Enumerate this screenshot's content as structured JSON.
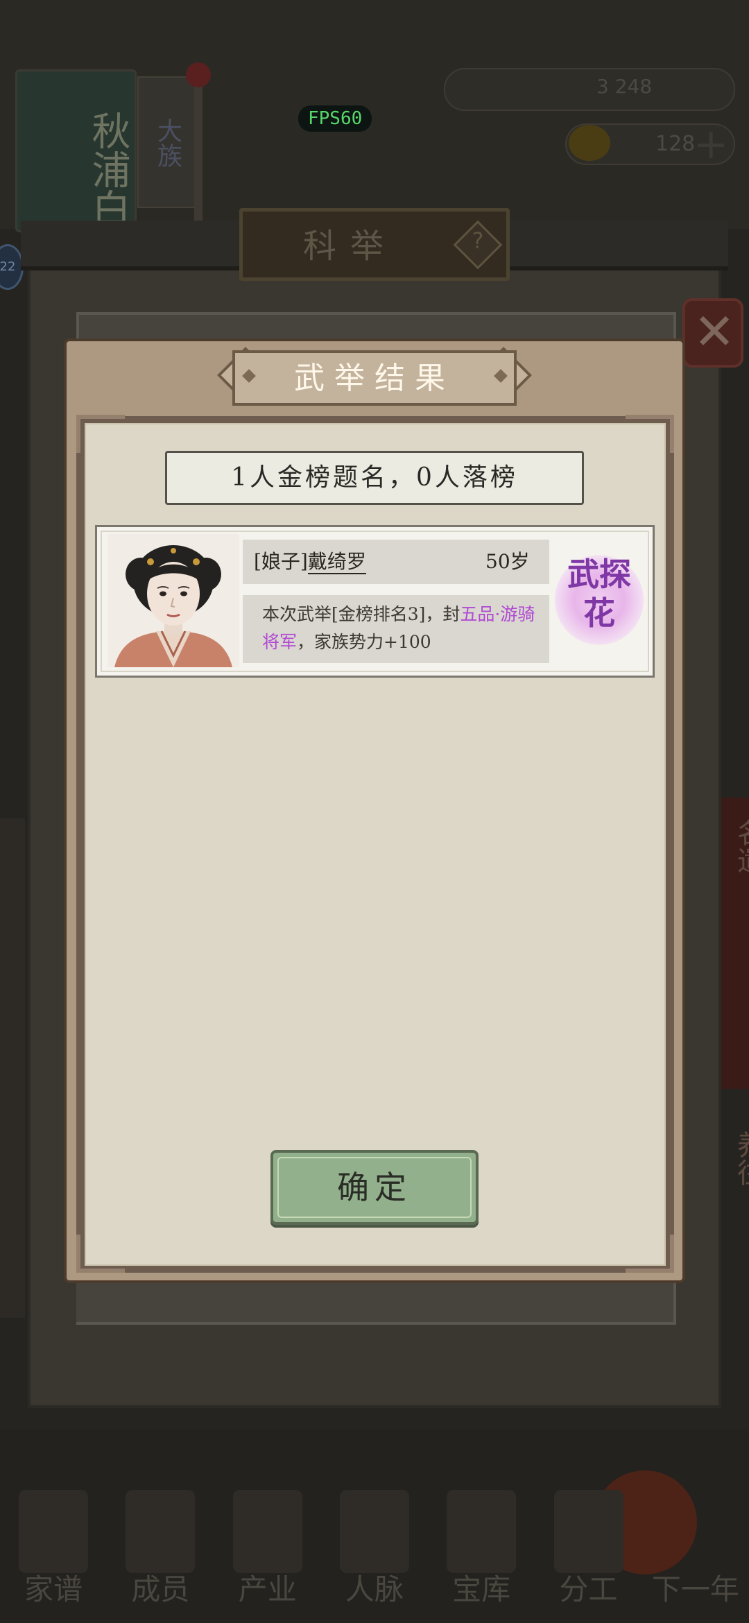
{
  "background": {
    "clan_banner": "秋浦白氏",
    "clan_tag": "大族",
    "fps_label": "FPS60",
    "resource_value": "3 248",
    "gold_value": "128",
    "round_badge": "22",
    "screen_title": "科举",
    "side_text_right_1": "名遣",
    "side_text_right_2": "养往",
    "nav": [
      {
        "label": "家谱"
      },
      {
        "label": "成员"
      },
      {
        "label": "产业"
      },
      {
        "label": "人脉"
      },
      {
        "label": "宝库"
      },
      {
        "label": "分工"
      },
      {
        "label": "下一年"
      }
    ]
  },
  "dialog": {
    "title": "武举结果",
    "summary": "1人金榜题名，0人落榜",
    "results": [
      {
        "title_prefix": "[娘子]",
        "name": "戴绮罗",
        "age": "50岁",
        "desc_before": "本次武举[金榜排名3]，封",
        "desc_rank": "五品·游骑将军",
        "desc_after": "，家族势力+100",
        "badge": "武探花"
      }
    ],
    "confirm_label": "确定"
  },
  "colors": {
    "dialog_frame": "#ad9982",
    "paper": "#dcd7c6",
    "rank_highlight": "#b149d4",
    "badge_text": "#7e37a4",
    "confirm_button": "#92b08b"
  }
}
